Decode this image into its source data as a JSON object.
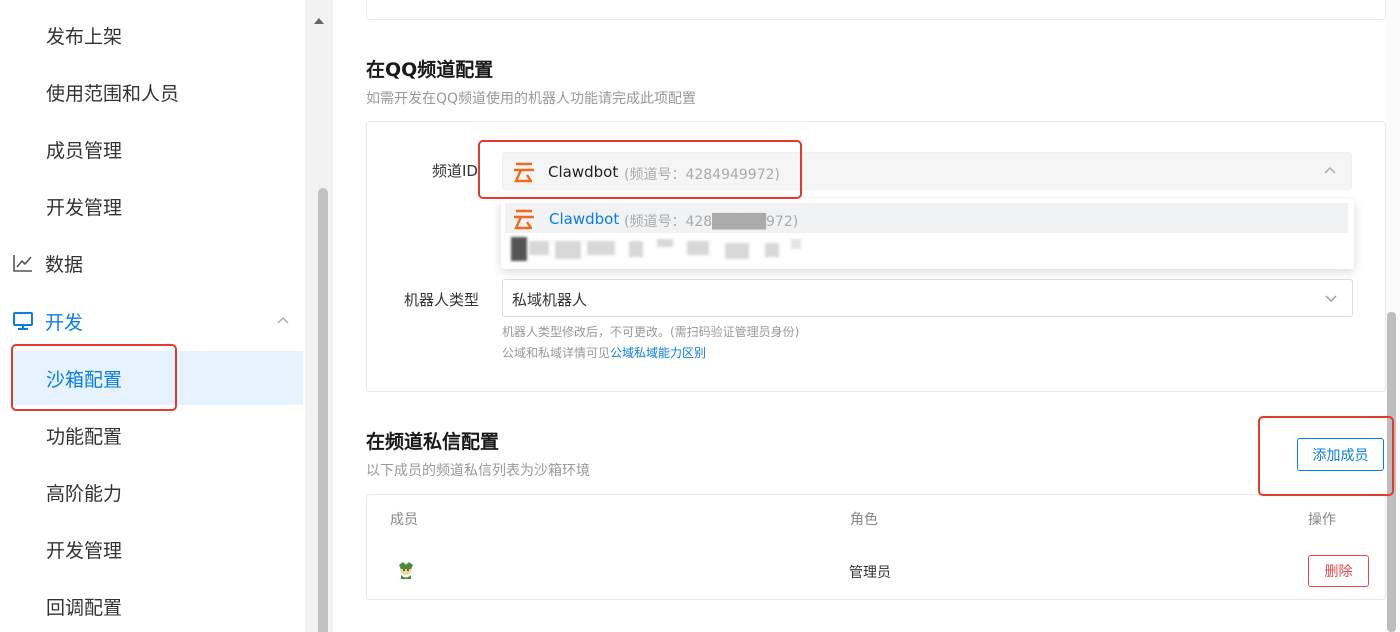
{
  "sidebar": {
    "items": [
      {
        "label": "发布上架"
      },
      {
        "label": "使用范围和人员"
      },
      {
        "label": "成员管理"
      },
      {
        "label": "开发管理"
      },
      {
        "label": "数据",
        "icon": "chart-icon"
      },
      {
        "label": "开发",
        "icon": "monitor-icon"
      },
      {
        "label": "沙箱配置"
      },
      {
        "label": "功能配置"
      },
      {
        "label": "高阶能力"
      },
      {
        "label": "开发管理"
      },
      {
        "label": "回调配置"
      }
    ]
  },
  "qq_channel": {
    "title": "在QQ频道配置",
    "desc": "如需开发在QQ频道使用的机器人功能请完成此项配置",
    "channel_id_label": "频道ID",
    "selected_name": "Clawdbot",
    "selected_number": "(频道号：4284949972)",
    "dropdown_option_name": "Clawdbot",
    "dropdown_option_number": "(频道号：428█████972)",
    "robot_type_label": "机器人类型",
    "robot_type_value": "私域机器人",
    "hint1": "机器人类型修改后，不可更改。(需扫码验证管理员身份)",
    "hint2_prefix": "公域和私域详情可见",
    "hint2_link": "公域私域能力区别"
  },
  "dm": {
    "title": "在频道私信配置",
    "desc": "以下成员的频道私信列表为沙箱环境",
    "add_button": "添加成员",
    "columns": [
      "成员",
      "角色",
      "操作"
    ],
    "rows": [
      {
        "role": "管理员",
        "action": "删除"
      }
    ]
  },
  "colors": {
    "accent": "#0a7ee0",
    "highlight": "#e23b2e",
    "danger": "#e5484d",
    "logo": "#f06a1e"
  }
}
